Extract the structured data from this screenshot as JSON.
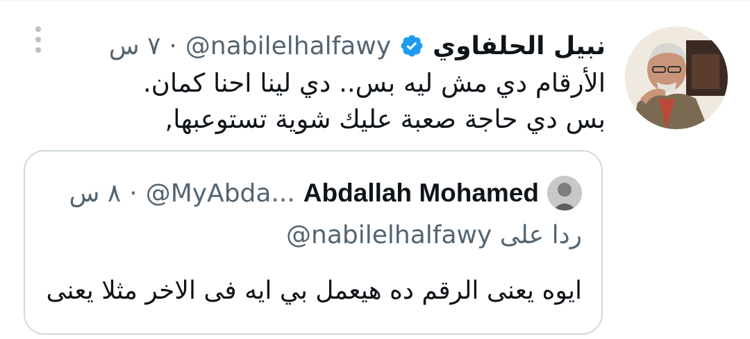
{
  "tweet": {
    "author": {
      "display_name": "نبيل الحلفاوي",
      "handle": "@nabilelhalfawy",
      "verified": true,
      "avatar": "profile-photo"
    },
    "separator": "·",
    "time": "٧ س",
    "body_lines": [
      "الأرقام دي مش ليه بس.. دي لينا احنا كمان.",
      "بس دي حاجة صعبة عليك شوية تستوعبها,"
    ],
    "menu_icon": "more-vertical-icon"
  },
  "quote": {
    "author": {
      "display_name": "Abdallah Mohamed",
      "handle": "@MyAbda...",
      "avatar": "profile-photo"
    },
    "separator": "·",
    "time": "٨ س",
    "replying_prefix": "ردا على",
    "replying_handle": "@nabilelhalfawy",
    "text": "ايوه يعنى الرقم ده هيعمل بي ايه فى الاخر مثلا يعنى"
  },
  "colors": {
    "text_primary": "#0f1419",
    "text_secondary": "#536471",
    "verified_blue": "#1d9bf0",
    "border": "#cfd9de"
  }
}
